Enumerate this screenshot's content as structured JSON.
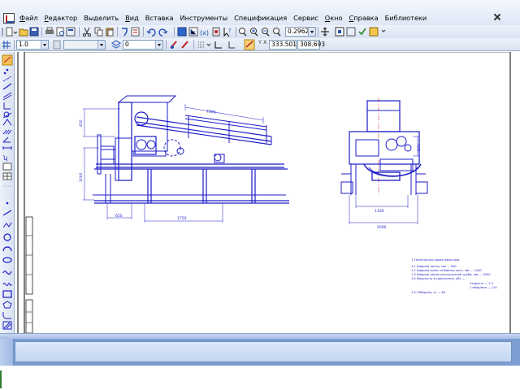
{
  "menu": {
    "items": [
      {
        "label": "Файл",
        "ul": "Ф",
        "rest": "айл"
      },
      {
        "label": "Редактор",
        "ul": "Р",
        "rest": "едактор"
      },
      {
        "label": "Выделить",
        "ul": "",
        "rest": "Выделить"
      },
      {
        "label": "Вид",
        "ul": "В",
        "rest": "ид"
      },
      {
        "label": "Вставка",
        "ul": "",
        "rest": "Вставка"
      },
      {
        "label": "Инструменты",
        "ul": "",
        "rest": "Инструменты"
      },
      {
        "label": "Спецификация",
        "ul": "",
        "rest": "Спецификация"
      },
      {
        "label": "Сервис",
        "ul": "",
        "rest": "Сервис"
      },
      {
        "label": "Окно",
        "ul": "О",
        "rest": "кно"
      },
      {
        "label": "Справка",
        "ul": "С",
        "rest": "правка"
      },
      {
        "label": "Библиотеки",
        "ul": "",
        "rest": "Библиотеки"
      }
    ]
  },
  "toolbar": {
    "zoom_value": "0.2962",
    "scale_value": "1.0",
    "layer_value": "0",
    "coord_x": "333.501",
    "coord_y": "308.693",
    "coord_axes_label": "Y X"
  },
  "drawing": {
    "dims": {
      "top_length": "1000",
      "height_left": "450",
      "height_lower": "1000",
      "bottom_small": "650",
      "bottom_span": "1750",
      "right_height": "870",
      "right_width_inner": "1100",
      "right_width_outer": "2000"
    },
    "notes": [
      "1 Техническая характеристика.",
      "1.1 Ширина ленты, мм  —  500",
      "1.2 Ширина колес отбойных лент, мм  —  1000",
      "1.3 Ширина ленты разгрузочной трубы, мм  —  3000",
      "1.4 Мощность эл.двигателя, кВт  —  ",
      "Скорость  —  2.2",
      "1 обор/мин  —  120",
      "1.5 Габариты, кг  —  60"
    ]
  },
  "colors": {
    "drawing_line": "#1c1cc8",
    "frame_line": "#000000",
    "menu_bg": "#e6edf8",
    "panel_blue": "#7d9ed3"
  }
}
